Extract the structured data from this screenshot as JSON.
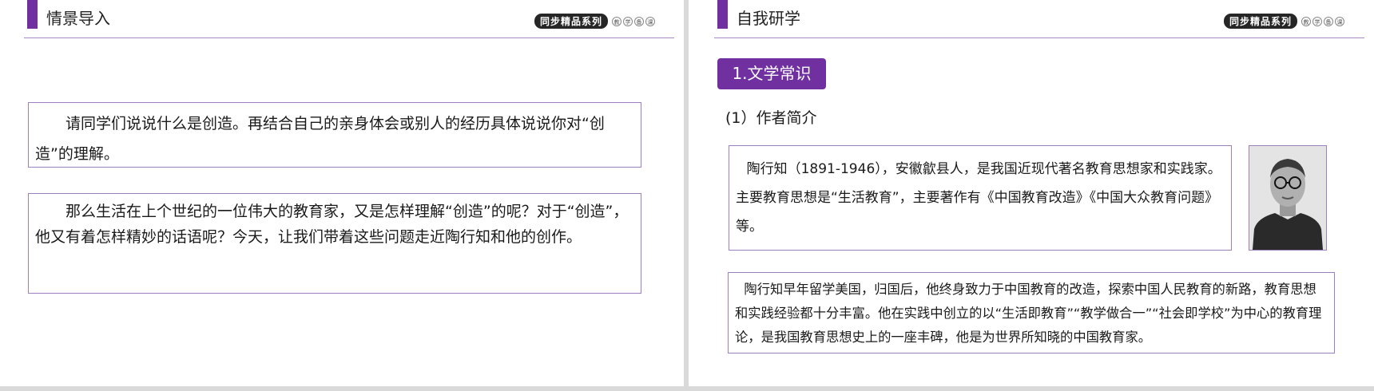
{
  "left": {
    "title": "情景导入",
    "brand": {
      "main": "同步精品系列",
      "sub": [
        "教",
        "学",
        "备",
        "课"
      ]
    },
    "paragraph1": "请同学们说说什么是创造。再结合自己的亲身体会或别人的经历具体说说你对“创造”的理解。",
    "paragraph2": "那么生活在上个世纪的一位伟大的教育家，又是怎样理解“创造”的呢？对于“创造”，他又有着怎样精妙的话语呢？今天，让我们带着这些问题走近陶行知和他的创作。"
  },
  "right": {
    "title": "自我研学",
    "brand": {
      "main": "同步精品系列",
      "sub": [
        "教",
        "学",
        "备",
        "课"
      ]
    },
    "section_tag": "1.文学常识",
    "subheading": "(1）作者简介",
    "paragraph1": "陶行知（1891-1946），安徽歙县人，是我国近现代著名教育思想家和实践家。主要教育思想是“生活教育”，主要著作有《中国教育改造》《中国大众教育问题》等。",
    "paragraph2": "陶行知早年留学美国，归国后，他终身致力于中国教育的改造，探索中国人民教育的新路，教育思想和实践经验都十分丰富。他在实践中创立的以“生活即教育”“教学做合一”“社会即学校”为中心的教育理论，是我国教育思想史上的一座丰碑，他是为世界所知晓的中国教育家。"
  },
  "colors": {
    "accent": "#7030a0",
    "frame_border": "#9e7fbf",
    "background": "#d9d9d9"
  }
}
